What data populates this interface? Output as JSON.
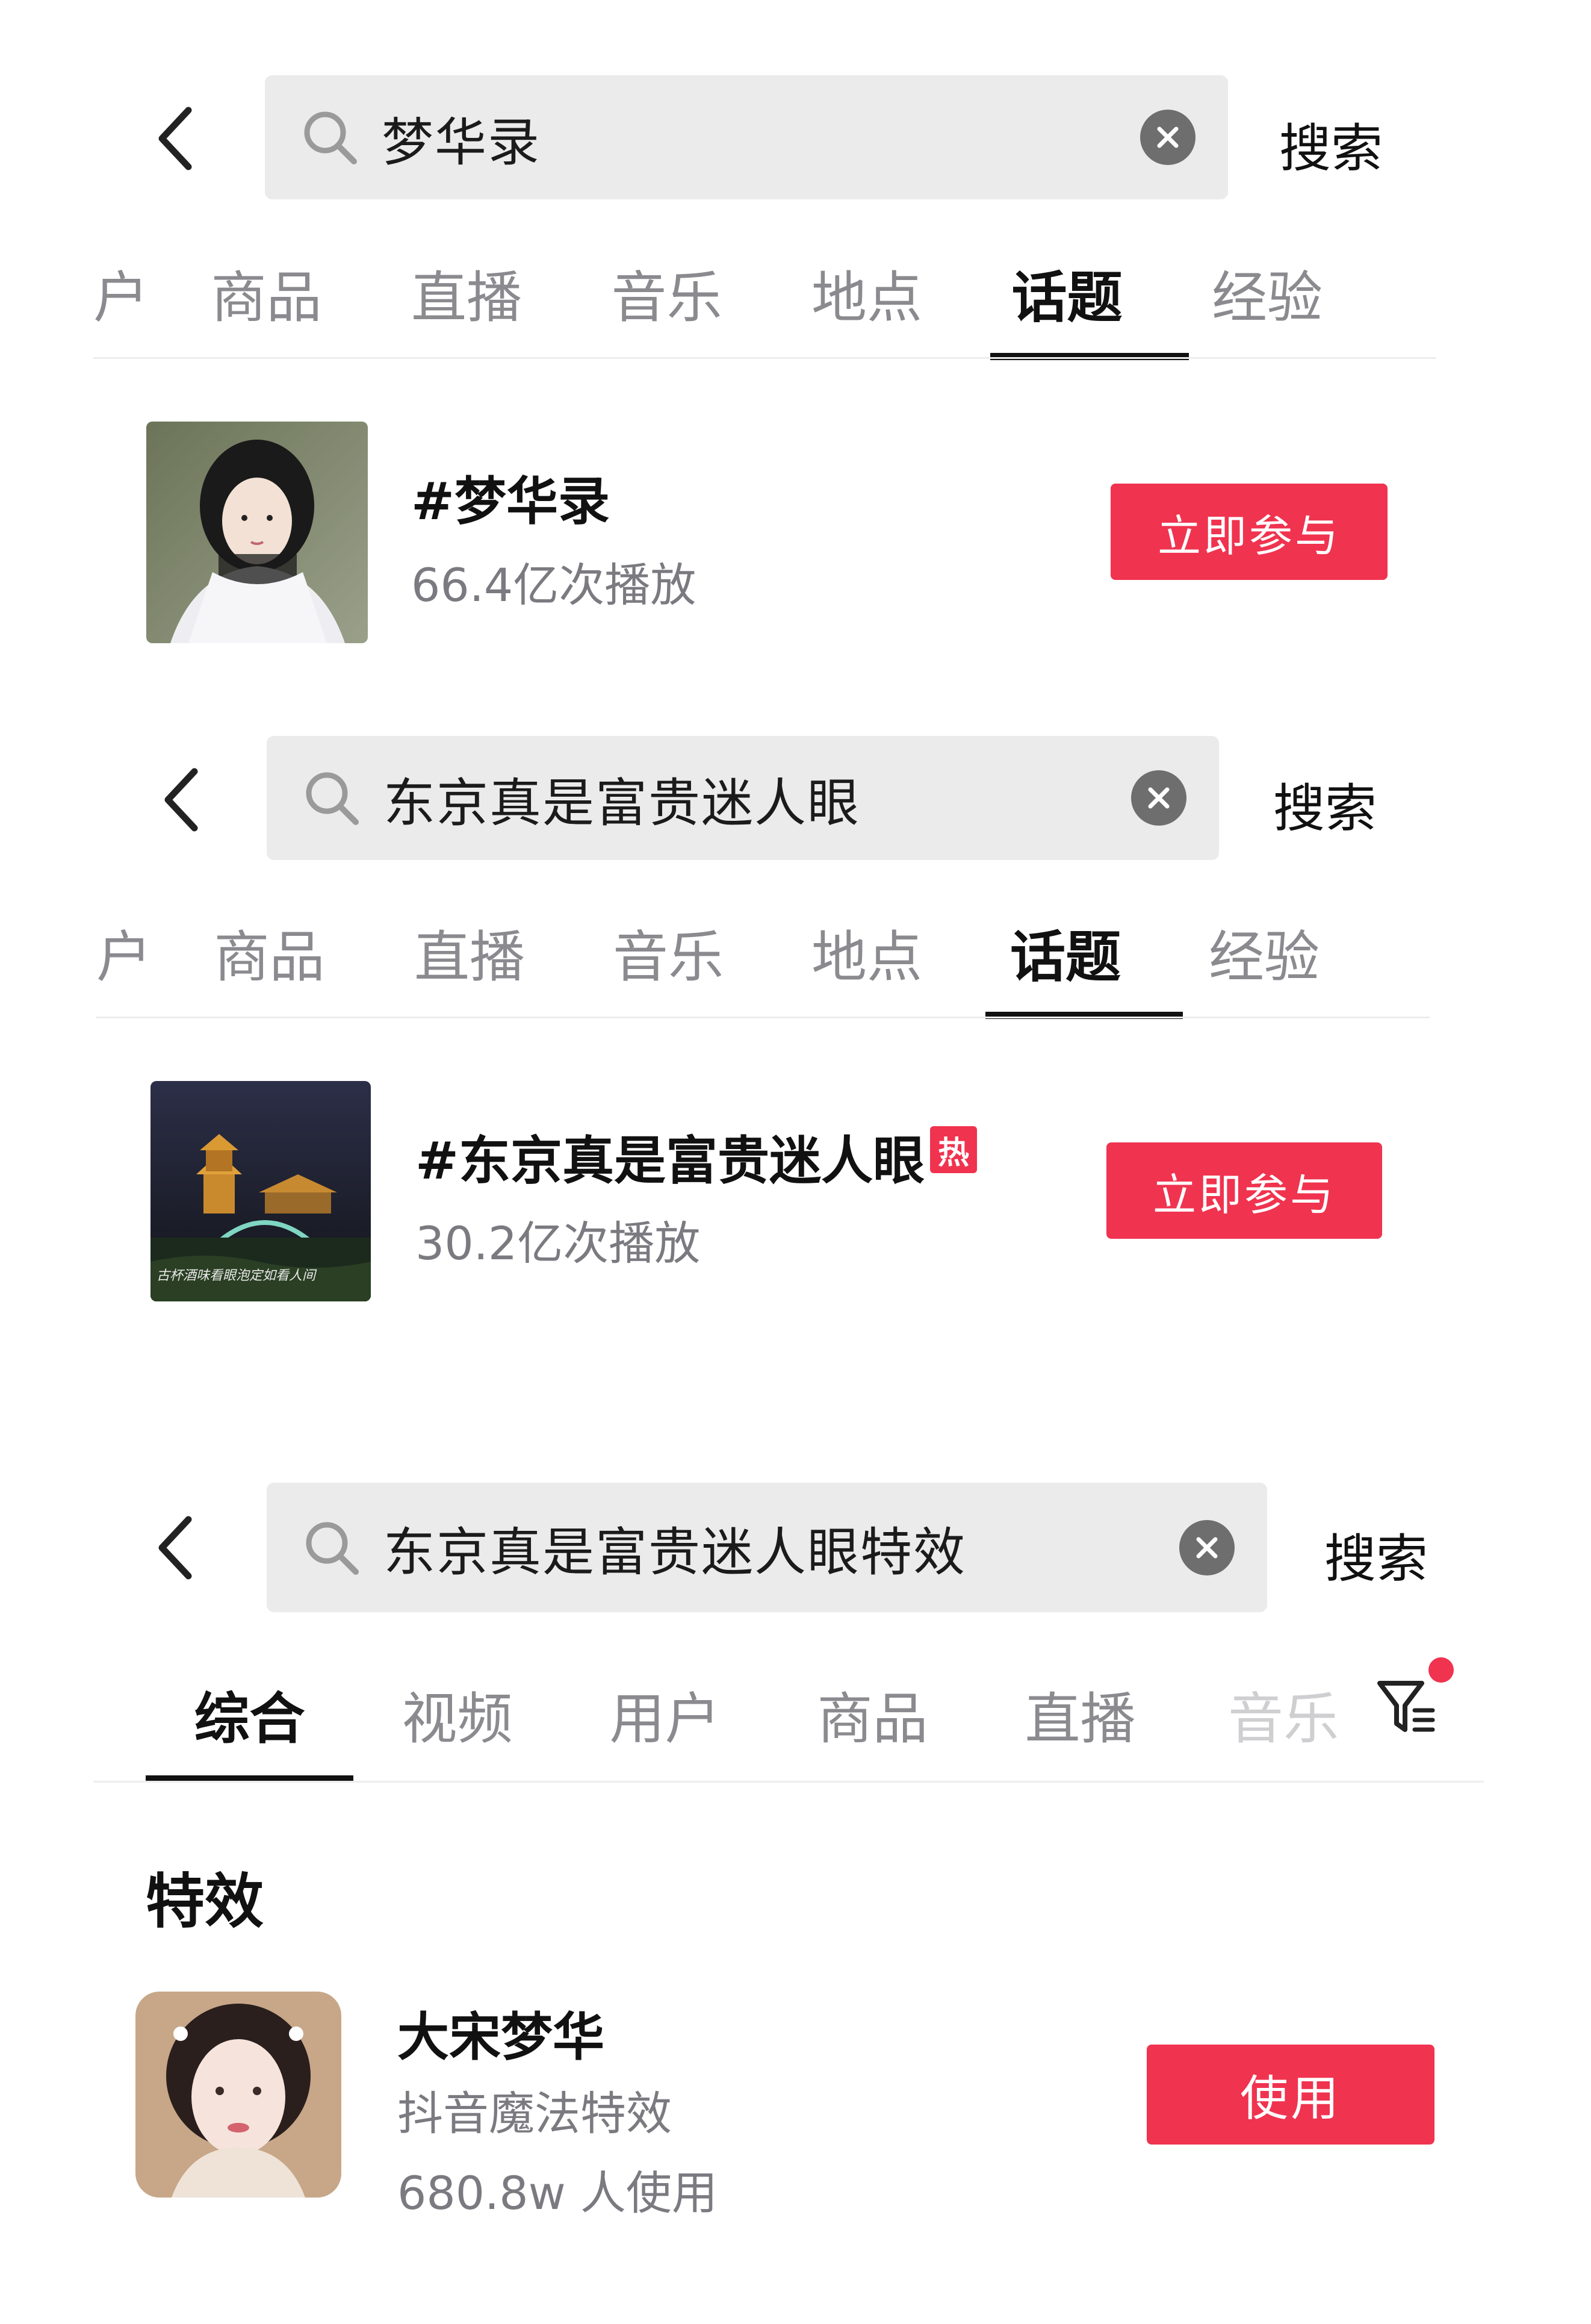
{
  "panel1": {
    "search": {
      "query": "梦华录",
      "button": "搜索"
    },
    "tabs": [
      "户",
      "商品",
      "直播",
      "音乐",
      "地点",
      "话题",
      "经验"
    ],
    "active_tab": "话题",
    "result": {
      "title": "#梦华录",
      "views": "66.4亿次播放",
      "action": "立即参与"
    }
  },
  "panel2": {
    "search": {
      "query": "东京真是富贵迷人眼",
      "button": "搜索"
    },
    "tabs": [
      "户",
      "商品",
      "直播",
      "音乐",
      "地点",
      "话题",
      "经验"
    ],
    "active_tab": "话题",
    "result": {
      "title": "#东京真是富贵迷人眼",
      "badge": "热",
      "views": "30.2亿次播放",
      "action": "立即参与",
      "thumb_caption": "古杯酒味看眼泡定如看人间"
    }
  },
  "panel3": {
    "search": {
      "query": "东京真是富贵迷人眼特效",
      "button": "搜索"
    },
    "tabs": [
      "综合",
      "视频",
      "用户",
      "商品",
      "直播",
      "音乐"
    ],
    "active_tab": "综合",
    "section_title": "特效",
    "effect": {
      "title": "大宋梦华",
      "source": "抖音魔法特效",
      "usage": "680.8w 人使用",
      "action": "使用"
    }
  },
  "colors": {
    "accent": "#f0334f",
    "search_bg": "#ebebeb",
    "text_primary": "#111111",
    "text_secondary": "#8a8a8f"
  },
  "icons": [
    "back-arrow-icon",
    "search-icon",
    "clear-icon",
    "filter-icon",
    "hot-badge"
  ]
}
